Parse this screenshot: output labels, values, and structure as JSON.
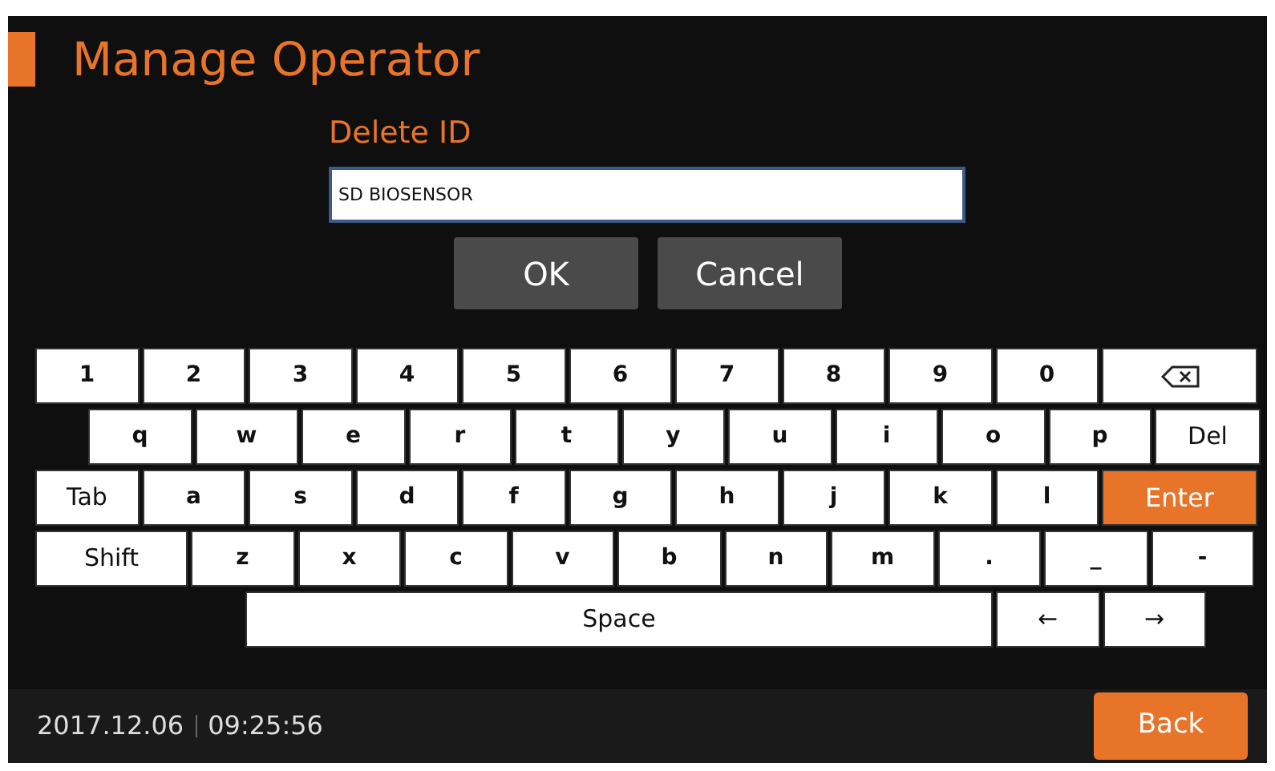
{
  "title": "Manage Operator",
  "subtitle": "Delete ID",
  "id_field": {
    "value": "SD BIOSENSOR"
  },
  "buttons": [
    "OK",
    "Cancel"
  ],
  "keyboard": {
    "rows": [
      [
        {
          "kind": "char",
          "label": "1"
        },
        {
          "kind": "char",
          "label": "2"
        },
        {
          "kind": "char",
          "label": "3"
        },
        {
          "kind": "char",
          "label": "4"
        },
        {
          "kind": "char",
          "label": "5"
        },
        {
          "kind": "char",
          "label": "6"
        },
        {
          "kind": "char",
          "label": "7"
        },
        {
          "kind": "char",
          "label": "8"
        },
        {
          "kind": "char",
          "label": "9"
        },
        {
          "kind": "char",
          "label": "0"
        },
        {
          "kind": "backspace"
        }
      ],
      [
        {
          "kind": "char",
          "label": "q"
        },
        {
          "kind": "char",
          "label": "w"
        },
        {
          "kind": "char",
          "label": "e"
        },
        {
          "kind": "char",
          "label": "r"
        },
        {
          "kind": "char",
          "label": "t"
        },
        {
          "kind": "char",
          "label": "y"
        },
        {
          "kind": "char",
          "label": "u"
        },
        {
          "kind": "char",
          "label": "i"
        },
        {
          "kind": "char",
          "label": "o"
        },
        {
          "kind": "char",
          "label": "p"
        },
        {
          "kind": "func",
          "label": "Del"
        }
      ],
      [
        {
          "kind": "func",
          "label": "Tab"
        },
        {
          "kind": "char",
          "label": "a"
        },
        {
          "kind": "char",
          "label": "s"
        },
        {
          "kind": "char",
          "label": "d"
        },
        {
          "kind": "char",
          "label": "f"
        },
        {
          "kind": "char",
          "label": "g"
        },
        {
          "kind": "char",
          "label": "h"
        },
        {
          "kind": "char",
          "label": "j"
        },
        {
          "kind": "char",
          "label": "k"
        },
        {
          "kind": "char",
          "label": "l"
        },
        {
          "kind": "enter",
          "label": "Enter"
        }
      ],
      [
        {
          "kind": "shift",
          "label": "Shift"
        },
        {
          "kind": "char",
          "label": "z"
        },
        {
          "kind": "char",
          "label": "x"
        },
        {
          "kind": "char",
          "label": "c"
        },
        {
          "kind": "char",
          "label": "v"
        },
        {
          "kind": "char",
          "label": "b"
        },
        {
          "kind": "char",
          "label": "n"
        },
        {
          "kind": "char",
          "label": "m"
        },
        {
          "kind": "char",
          "label": "."
        },
        {
          "kind": "char",
          "label": "_"
        },
        {
          "kind": "char",
          "label": "-"
        }
      ],
      [
        {
          "kind": "space",
          "label": "Space"
        },
        {
          "kind": "func",
          "label": "←"
        },
        {
          "kind": "func",
          "label": "→"
        }
      ]
    ]
  },
  "status_bar": {
    "date": "2017.12.06",
    "time": "09:25:56",
    "back": "Back"
  }
}
